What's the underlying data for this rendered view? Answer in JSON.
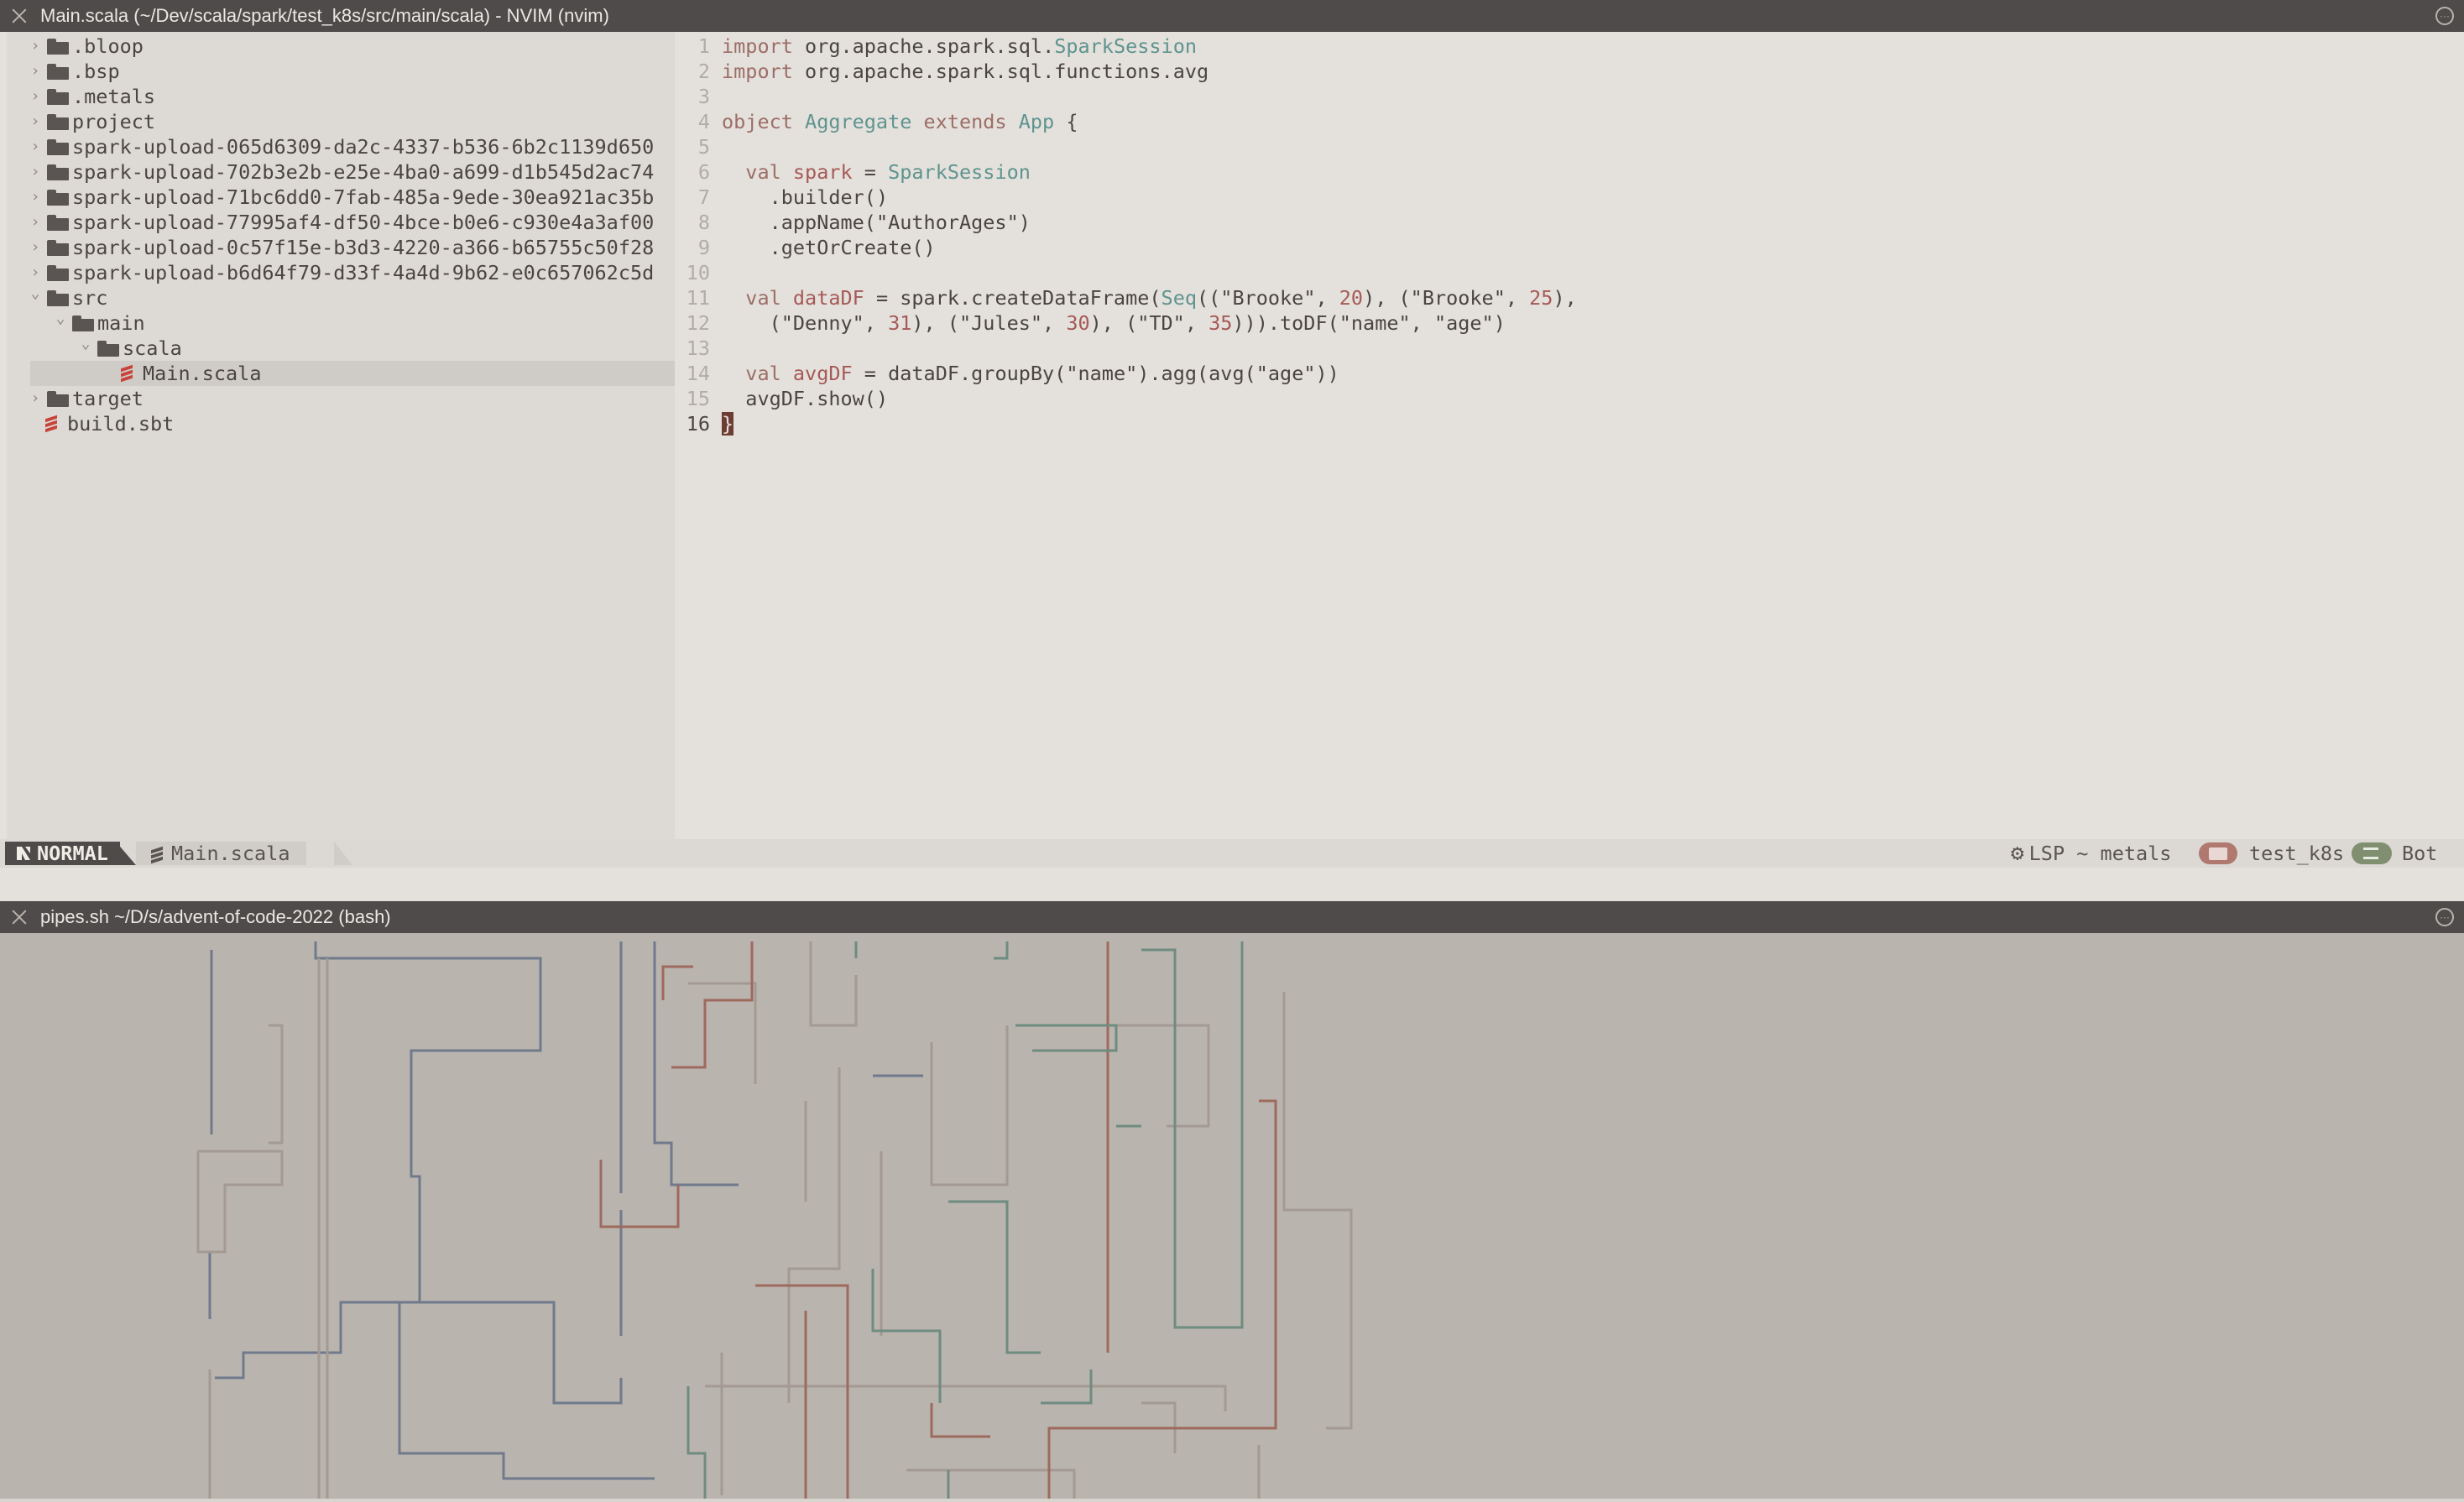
{
  "windows": {
    "top_title": "Main.scala (~/Dev/scala/spark/test_k8s/src/main/scala) - NVIM (nvim)",
    "bottom_title": "pipes.sh  ~/D/s/advent-of-code-2022 (bash)"
  },
  "tree": {
    "items": [
      {
        "label": ".bloop"
      },
      {
        "label": ".bsp"
      },
      {
        "label": ".metals"
      },
      {
        "label": "project"
      },
      {
        "label": "spark-upload-065d6309-da2c-4337-b536-6b2c1139d650"
      },
      {
        "label": "spark-upload-702b3e2b-e25e-4ba0-a699-d1b545d2ac74"
      },
      {
        "label": "spark-upload-71bc6dd0-7fab-485a-9ede-30ea921ac35b"
      },
      {
        "label": "spark-upload-77995af4-df50-4bce-b0e6-c930e4a3af00"
      },
      {
        "label": "spark-upload-0c57f15e-b3d3-4220-a366-b65755c50f28"
      },
      {
        "label": "spark-upload-b6d64f79-d33f-4a4d-9b62-e0c657062c5d"
      },
      {
        "label": "src"
      },
      {
        "label": "main"
      },
      {
        "label": "scala"
      },
      {
        "label": "Main.scala"
      },
      {
        "label": "target"
      },
      {
        "label": "build.sbt"
      }
    ]
  },
  "editor": {
    "line_numbers": [
      "1",
      "2",
      "3",
      "4",
      "5",
      "6",
      "7",
      "8",
      "9",
      "10",
      "11",
      "12",
      "13",
      "14",
      "15",
      "16"
    ],
    "lines": [
      "import org.apache.spark.sql.SparkSession",
      "import org.apache.spark.sql.functions.avg",
      "",
      "object Aggregate extends App {",
      "",
      "  val spark = SparkSession",
      "    .builder()",
      "    .appName(\"AuthorAges\")",
      "    .getOrCreate()",
      "",
      "  val dataDF = spark.createDataFrame(Seq((\"Brooke\", 20), (\"Brooke\", 25),",
      "    (\"Denny\", 31), (\"Jules\", 30), (\"TD\", 35))).toDF(\"name\", \"age\")",
      "",
      "  val avgDF = dataDF.groupBy(\"name\").agg(avg(\"age\"))",
      "  avgDF.show()",
      "}"
    ],
    "cursor_line": "16"
  },
  "statusline": {
    "mode": "NORMAL",
    "file": "Main.scala",
    "lsp": "LSP ~ metals",
    "project": "test_k8s",
    "position": "Bot"
  },
  "colors": {
    "keyword": "#9c6e66",
    "type": "#5f948e",
    "number": "#a55a57",
    "scala_icon": "#c8443a"
  }
}
